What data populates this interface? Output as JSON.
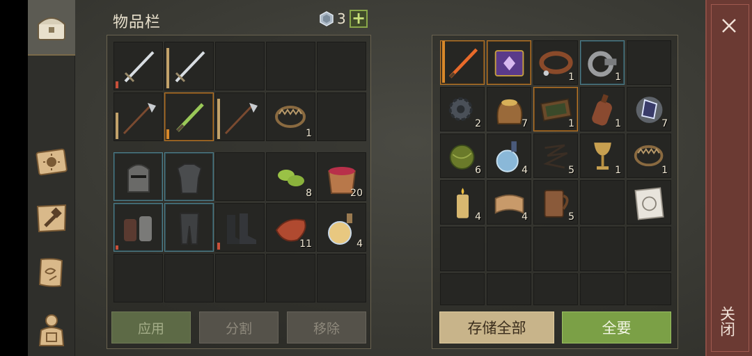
{
  "inventory": {
    "title": "物品栏",
    "currency_count": "3",
    "add_label": "+",
    "buttons": {
      "apply": "应用",
      "split": "分割",
      "remove": "移除"
    },
    "items": {
      "trap": "1",
      "leaves": "8",
      "berry_bucket": "20",
      "meat": "11",
      "potion": "4"
    }
  },
  "storage": {
    "items": {
      "collar": "1",
      "shackle": "1",
      "gear": "2",
      "grain_sack": "7",
      "tray": "1",
      "bottle": "1",
      "crystal": "7",
      "fiber_ball": "6",
      "water_flask": "4",
      "rope": "5",
      "goblet": "1",
      "trap": "1",
      "candle": "4",
      "leather": "4",
      "mug": "5"
    },
    "buttons": {
      "store_all": "存储全部",
      "take_all": "全要"
    }
  },
  "close_label": "关闭",
  "colors": {
    "accent_green": "#7ba046",
    "accent_tan": "#c8b48a",
    "close_panel": "#6b3a33"
  }
}
